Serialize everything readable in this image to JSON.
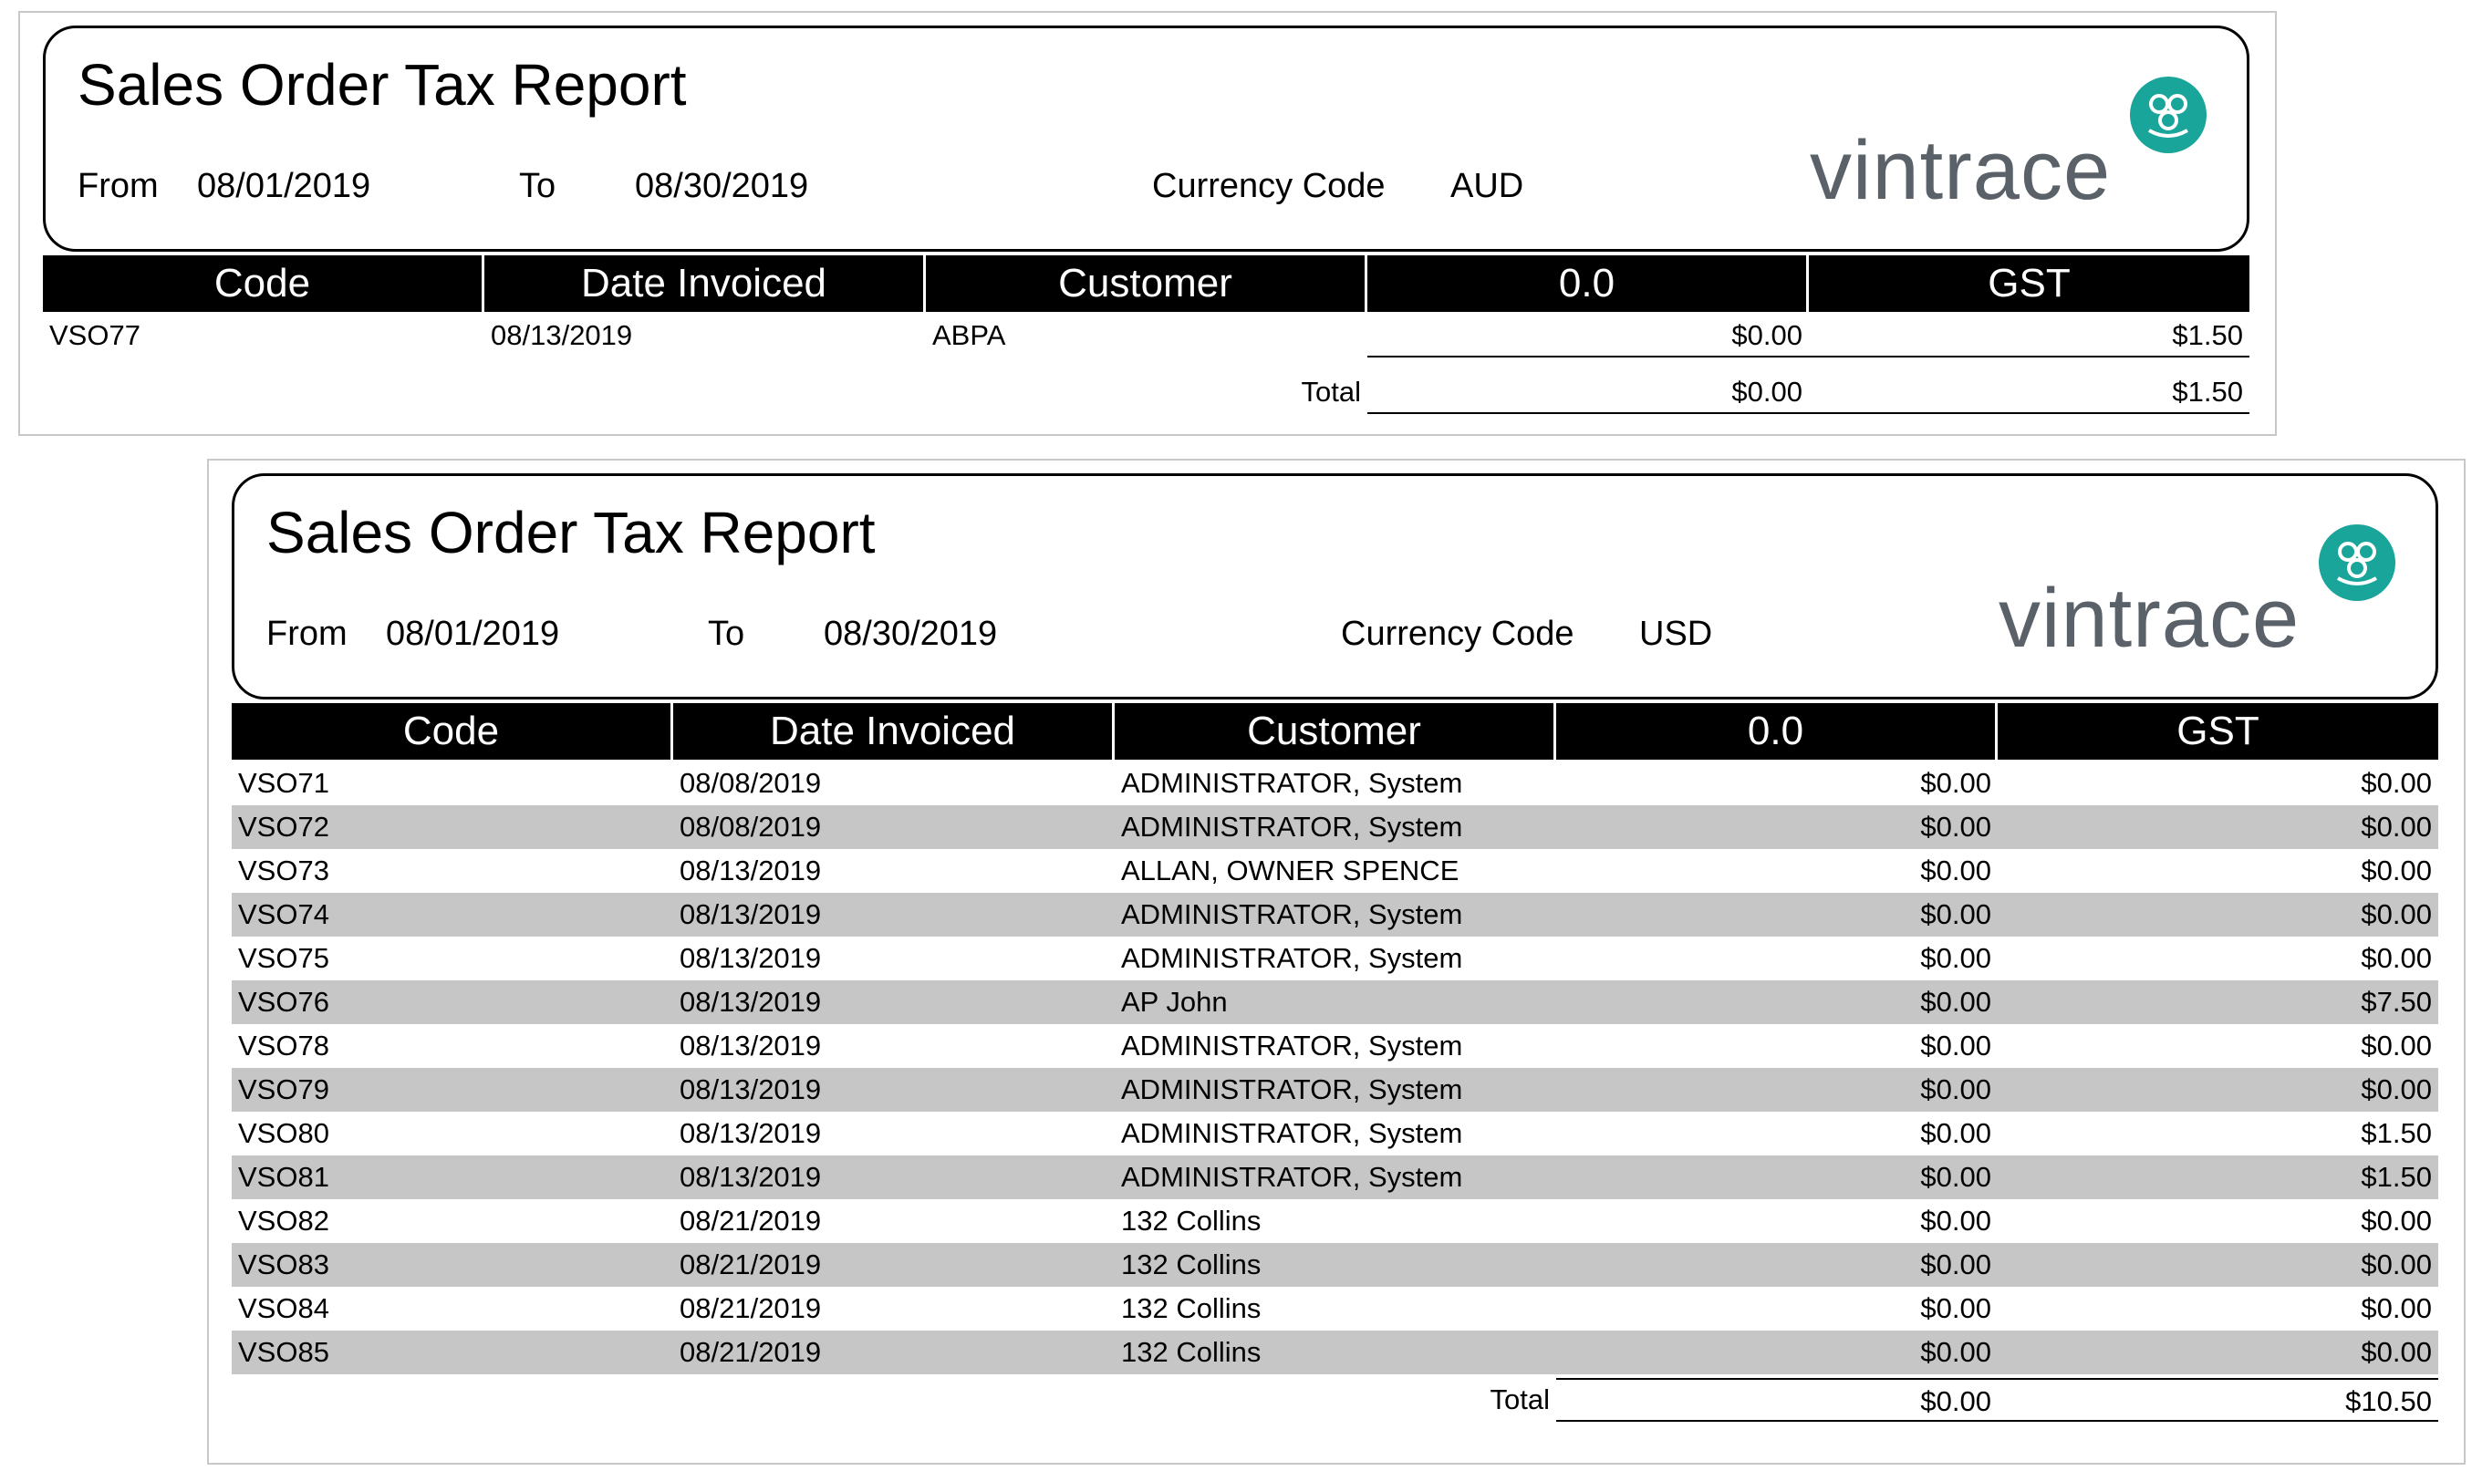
{
  "reports": [
    {
      "title": "Sales Order Tax Report",
      "from_label": "From",
      "from_value": "08/01/2019",
      "to_label": "To",
      "to_value": "08/30/2019",
      "currency_label": "Currency Code",
      "currency_value": "AUD",
      "logo_text": "vintrace",
      "columns": [
        "Code",
        "Date Invoiced",
        "Customer",
        "0.0",
        "GST"
      ],
      "rows": [
        {
          "code": "VSO77",
          "date": "08/13/2019",
          "customer": "ABPA",
          "zero": "$0.00",
          "gst": "$1.50"
        }
      ],
      "total_label": "Total",
      "total_zero": "$0.00",
      "total_gst": "$1.50"
    },
    {
      "title": "Sales Order Tax Report",
      "from_label": "From",
      "from_value": "08/01/2019",
      "to_label": "To",
      "to_value": "08/30/2019",
      "currency_label": "Currency Code",
      "currency_value": "USD",
      "logo_text": "vintrace",
      "columns": [
        "Code",
        "Date Invoiced",
        "Customer",
        "0.0",
        "GST"
      ],
      "rows": [
        {
          "code": "VSO71",
          "date": "08/08/2019",
          "customer": "ADMINISTRATOR, System",
          "zero": "$0.00",
          "gst": "$0.00"
        },
        {
          "code": "VSO72",
          "date": "08/08/2019",
          "customer": "ADMINISTRATOR, System",
          "zero": "$0.00",
          "gst": "$0.00"
        },
        {
          "code": "VSO73",
          "date": "08/13/2019",
          "customer": "ALLAN, OWNER SPENCE",
          "zero": "$0.00",
          "gst": "$0.00"
        },
        {
          "code": "VSO74",
          "date": "08/13/2019",
          "customer": "ADMINISTRATOR, System",
          "zero": "$0.00",
          "gst": "$0.00"
        },
        {
          "code": "VSO75",
          "date": "08/13/2019",
          "customer": "ADMINISTRATOR, System",
          "zero": "$0.00",
          "gst": "$0.00"
        },
        {
          "code": "VSO76",
          "date": "08/13/2019",
          "customer": "AP John",
          "zero": "$0.00",
          "gst": "$7.50"
        },
        {
          "code": "VSO78",
          "date": "08/13/2019",
          "customer": "ADMINISTRATOR, System",
          "zero": "$0.00",
          "gst": "$0.00"
        },
        {
          "code": "VSO79",
          "date": "08/13/2019",
          "customer": "ADMINISTRATOR, System",
          "zero": "$0.00",
          "gst": "$0.00"
        },
        {
          "code": "VSO80",
          "date": "08/13/2019",
          "customer": "ADMINISTRATOR, System",
          "zero": "$0.00",
          "gst": "$1.50"
        },
        {
          "code": "VSO81",
          "date": "08/13/2019",
          "customer": "ADMINISTRATOR, System",
          "zero": "$0.00",
          "gst": "$1.50"
        },
        {
          "code": "VSO82",
          "date": "08/21/2019",
          "customer": "132 Collins",
          "zero": "$0.00",
          "gst": "$0.00"
        },
        {
          "code": "VSO83",
          "date": "08/21/2019",
          "customer": "132 Collins",
          "zero": "$0.00",
          "gst": "$0.00"
        },
        {
          "code": "VSO84",
          "date": "08/21/2019",
          "customer": "132 Collins",
          "zero": "$0.00",
          "gst": "$0.00"
        },
        {
          "code": "VSO85",
          "date": "08/21/2019",
          "customer": "132 Collins",
          "zero": "$0.00",
          "gst": "$0.00"
        }
      ],
      "total_label": "Total",
      "total_zero": "$0.00",
      "total_gst": "$10.50"
    }
  ],
  "colors": {
    "header_bg": "#000000",
    "row_shade": "#c6c6c6",
    "logo_teal": "#1aa59a",
    "logo_text": "#5a6168"
  }
}
